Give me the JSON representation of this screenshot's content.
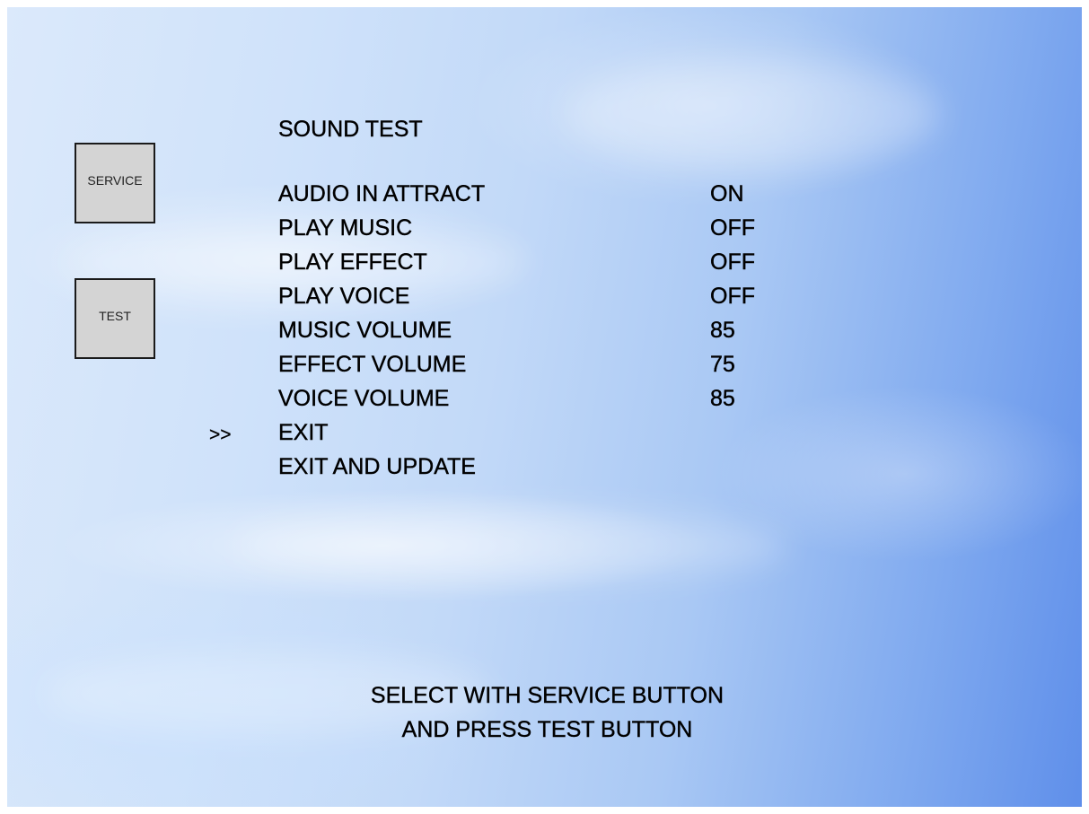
{
  "screen": {
    "title": "SOUND TEST",
    "cursor": ">>",
    "buttons": {
      "service": "SERVICE",
      "test": "TEST"
    },
    "menu": [
      {
        "label": "AUDIO IN ATTRACT",
        "value": "ON"
      },
      {
        "label": "PLAY MUSIC",
        "value": "OFF"
      },
      {
        "label": "PLAY EFFECT",
        "value": "OFF"
      },
      {
        "label": "PLAY VOICE",
        "value": "OFF"
      },
      {
        "label": "MUSIC VOLUME",
        "value": "85"
      },
      {
        "label": "EFFECT VOLUME",
        "value": "75"
      },
      {
        "label": "VOICE VOLUME",
        "value": "85"
      },
      {
        "label": "EXIT",
        "value": ""
      },
      {
        "label": "EXIT AND UPDATE",
        "value": ""
      }
    ],
    "selected_item": "EXIT",
    "instructions": {
      "line1": "SELECT WITH SERVICE BUTTON",
      "line2": "AND PRESS TEST BUTTON"
    }
  }
}
